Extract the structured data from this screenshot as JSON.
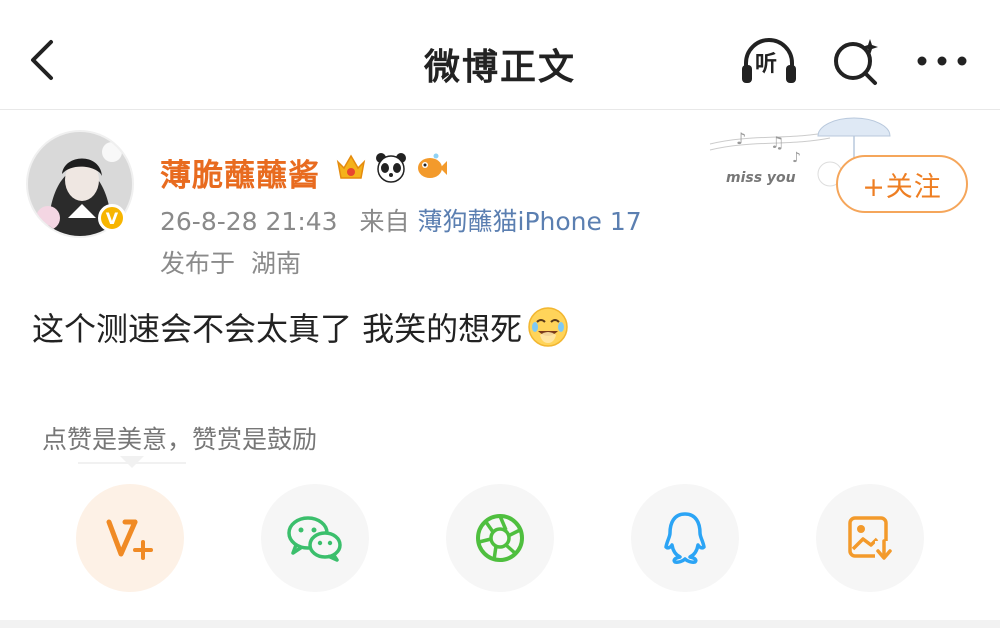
{
  "header": {
    "title": "微博正文",
    "icons": {
      "back": "chevron-left-icon",
      "listen": "headphones-listen-icon",
      "listen_glyph": "听",
      "search": "search-sparkle-icon",
      "more": "more-dots-icon"
    }
  },
  "post": {
    "username": "薄脆蘸蘸酱",
    "badges": [
      "crown-badge-icon",
      "panda-badge-icon",
      "fish-badge-icon"
    ],
    "time": "26-8-28 21:43",
    "from_label": "来自",
    "device": "薄狗蘸猫iPhone 17",
    "location_label": "发布于",
    "location": "湖南",
    "text": "这个测速会不会太真了 我笑的想死",
    "emoji": "laughing-crying-emoji-icon",
    "follow_label": "+关注",
    "deco_text": "miss you"
  },
  "reward": {
    "hint": "点赞是美意，赞赏是鼓励"
  },
  "share": [
    {
      "name": "reward-v-icon",
      "color": "#f08a24"
    },
    {
      "name": "wechat-icon",
      "color": "#3bbf6c"
    },
    {
      "name": "moments-icon",
      "color": "#4fbf3f"
    },
    {
      "name": "qq-icon",
      "color": "#2ba4f5"
    },
    {
      "name": "save-image-icon",
      "color": "#f39a2b"
    }
  ]
}
